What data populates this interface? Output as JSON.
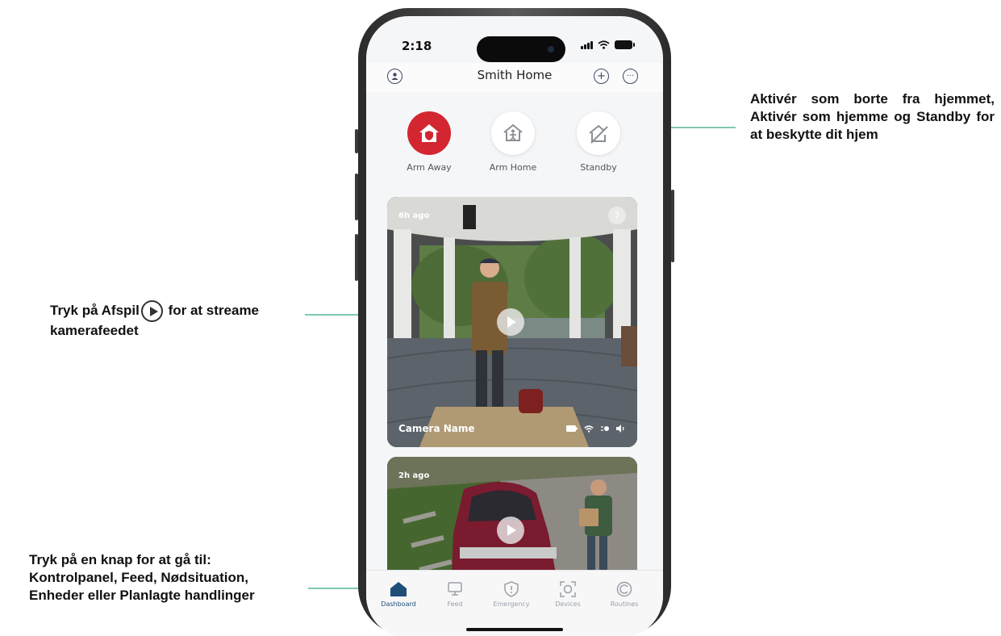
{
  "annotations": {
    "modes_text": "Aktivér som borte fra hjemmet, Aktivér som hjemme og Standby for at beskytte dit hjem",
    "play_text_before": "Tryk på Afspil",
    "play_text_after": " for at streame kamerafeedet",
    "nav_line1": "Tryk på en knap for at gå til:",
    "nav_line2": "Kontrolpanel, Feed, Nødsituation,",
    "nav_line3": "Enheder eller Planlagte handlinger"
  },
  "status_bar": {
    "time": "2:18"
  },
  "app_bar": {
    "title": "Smith Home",
    "icons": [
      "user-icon",
      "add-icon",
      "more-icon"
    ]
  },
  "modes": [
    {
      "label": "Arm Away",
      "color": "#d32630",
      "icon": "home-shield-icon",
      "active": true
    },
    {
      "label": "Arm Home",
      "color": "#ffffff",
      "icon": "home-person-icon",
      "active": false
    },
    {
      "label": "Standby",
      "color": "#ffffff",
      "icon": "home-off-icon",
      "active": false
    }
  ],
  "cameras": [
    {
      "time": "6h ago",
      "count": "7",
      "name": "Camera Name"
    },
    {
      "time": "2h ago"
    }
  ],
  "tabs": [
    {
      "label": "Dashboard",
      "icon": "home-icon",
      "active": true
    },
    {
      "label": "Feed",
      "icon": "monitor-icon",
      "active": false
    },
    {
      "label": "Emergency",
      "icon": "shield-alert-icon",
      "active": false
    },
    {
      "label": "Devices",
      "icon": "camera-devices-icon",
      "active": false
    },
    {
      "label": "Routines",
      "icon": "routines-icon",
      "active": false
    }
  ],
  "colors": {
    "accent_red": "#d32630",
    "nav_active": "#1f4e79",
    "leader_line": "#7ec8b4"
  }
}
